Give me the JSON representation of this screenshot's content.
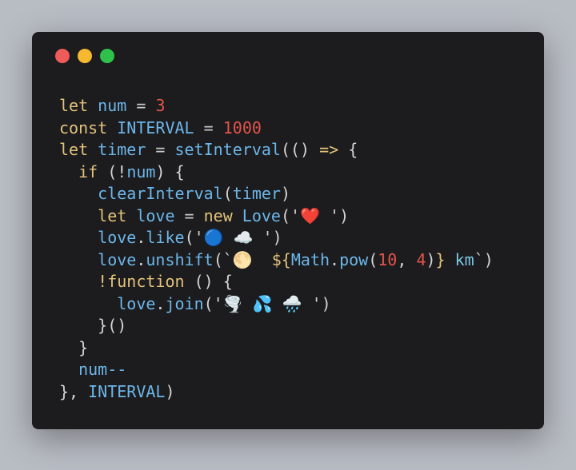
{
  "window": {
    "controls": [
      {
        "name": "close",
        "color": "#ef5b58"
      },
      {
        "name": "minimize",
        "color": "#f5b82e"
      },
      {
        "name": "maximize",
        "color": "#2fc14a"
      }
    ]
  },
  "code": {
    "lines": [
      [
        {
          "t": "let",
          "c": "kw"
        },
        {
          "t": " num ",
          "c": "var"
        },
        {
          "t": "= ",
          "c": "op"
        },
        {
          "t": "3",
          "c": "num"
        }
      ],
      [
        {
          "t": "const",
          "c": "kw"
        },
        {
          "t": " INTERVAL ",
          "c": "var"
        },
        {
          "t": "= ",
          "c": "op"
        },
        {
          "t": "1000",
          "c": "num"
        }
      ],
      [
        {
          "t": "let",
          "c": "kw"
        },
        {
          "t": " timer ",
          "c": "var"
        },
        {
          "t": "= ",
          "c": "op"
        },
        {
          "t": "setInterval",
          "c": "fn"
        },
        {
          "t": "(() ",
          "c": "pun"
        },
        {
          "t": "=>",
          "c": "kw"
        },
        {
          "t": " {",
          "c": "pun"
        }
      ],
      [
        {
          "t": "  ",
          "c": "pun"
        },
        {
          "t": "if",
          "c": "kw"
        },
        {
          "t": " (!",
          "c": "pun"
        },
        {
          "t": "num",
          "c": "var"
        },
        {
          "t": ") {",
          "c": "pun"
        }
      ],
      [
        {
          "t": "    ",
          "c": "pun"
        },
        {
          "t": "clearInterval",
          "c": "fn"
        },
        {
          "t": "(",
          "c": "pun"
        },
        {
          "t": "timer",
          "c": "var"
        },
        {
          "t": ")",
          "c": "pun"
        }
      ],
      [
        {
          "t": "    ",
          "c": "pun"
        },
        {
          "t": "let",
          "c": "kw"
        },
        {
          "t": " love ",
          "c": "var"
        },
        {
          "t": "= ",
          "c": "op"
        },
        {
          "t": "new",
          "c": "kw"
        },
        {
          "t": " Love",
          "c": "fn"
        },
        {
          "t": "('",
          "c": "pun"
        },
        {
          "t": "❤️ ",
          "c": "str"
        },
        {
          "t": "')",
          "c": "pun"
        }
      ],
      [
        {
          "t": "    ",
          "c": "pun"
        },
        {
          "t": "love",
          "c": "var"
        },
        {
          "t": ".",
          "c": "pun"
        },
        {
          "t": "like",
          "c": "fn"
        },
        {
          "t": "('",
          "c": "pun"
        },
        {
          "t": "🔵 ☁️ ",
          "c": "str"
        },
        {
          "t": "')",
          "c": "pun"
        }
      ],
      [
        {
          "t": "    ",
          "c": "pun"
        },
        {
          "t": "love",
          "c": "var"
        },
        {
          "t": ".",
          "c": "pun"
        },
        {
          "t": "unshift",
          "c": "fn"
        },
        {
          "t": "(`",
          "c": "pun"
        },
        {
          "t": "🌕  ",
          "c": "str"
        },
        {
          "t": "${",
          "c": "kw"
        },
        {
          "t": "Math",
          "c": "var"
        },
        {
          "t": ".",
          "c": "pun"
        },
        {
          "t": "pow",
          "c": "fn"
        },
        {
          "t": "(",
          "c": "pun"
        },
        {
          "t": "10",
          "c": "num"
        },
        {
          "t": ", ",
          "c": "pun"
        },
        {
          "t": "4",
          "c": "num"
        },
        {
          "t": ")",
          "c": "pun"
        },
        {
          "t": "}",
          "c": "kw"
        },
        {
          "t": " km",
          "c": "str"
        },
        {
          "t": "`)",
          "c": "pun"
        }
      ],
      [
        {
          "t": "    ",
          "c": "pun"
        },
        {
          "t": "!function",
          "c": "kw"
        },
        {
          "t": " () {",
          "c": "pun"
        }
      ],
      [
        {
          "t": "      ",
          "c": "pun"
        },
        {
          "t": "love",
          "c": "var"
        },
        {
          "t": ".",
          "c": "pun"
        },
        {
          "t": "join",
          "c": "fn"
        },
        {
          "t": "('",
          "c": "pun"
        },
        {
          "t": "🌪️ 💦 🌧️ ",
          "c": "str"
        },
        {
          "t": "')",
          "c": "pun"
        }
      ],
      [
        {
          "t": "    ",
          "c": "pun"
        },
        {
          "t": "}()",
          "c": "pun"
        }
      ],
      [
        {
          "t": "  ",
          "c": "pun"
        },
        {
          "t": "}",
          "c": "pun"
        }
      ],
      [
        {
          "t": "  ",
          "c": "pun"
        },
        {
          "t": "num--",
          "c": "var"
        }
      ],
      [
        {
          "t": "}, ",
          "c": "pun"
        },
        {
          "t": "INTERVAL",
          "c": "var"
        },
        {
          "t": ")",
          "c": "pun"
        }
      ]
    ]
  }
}
